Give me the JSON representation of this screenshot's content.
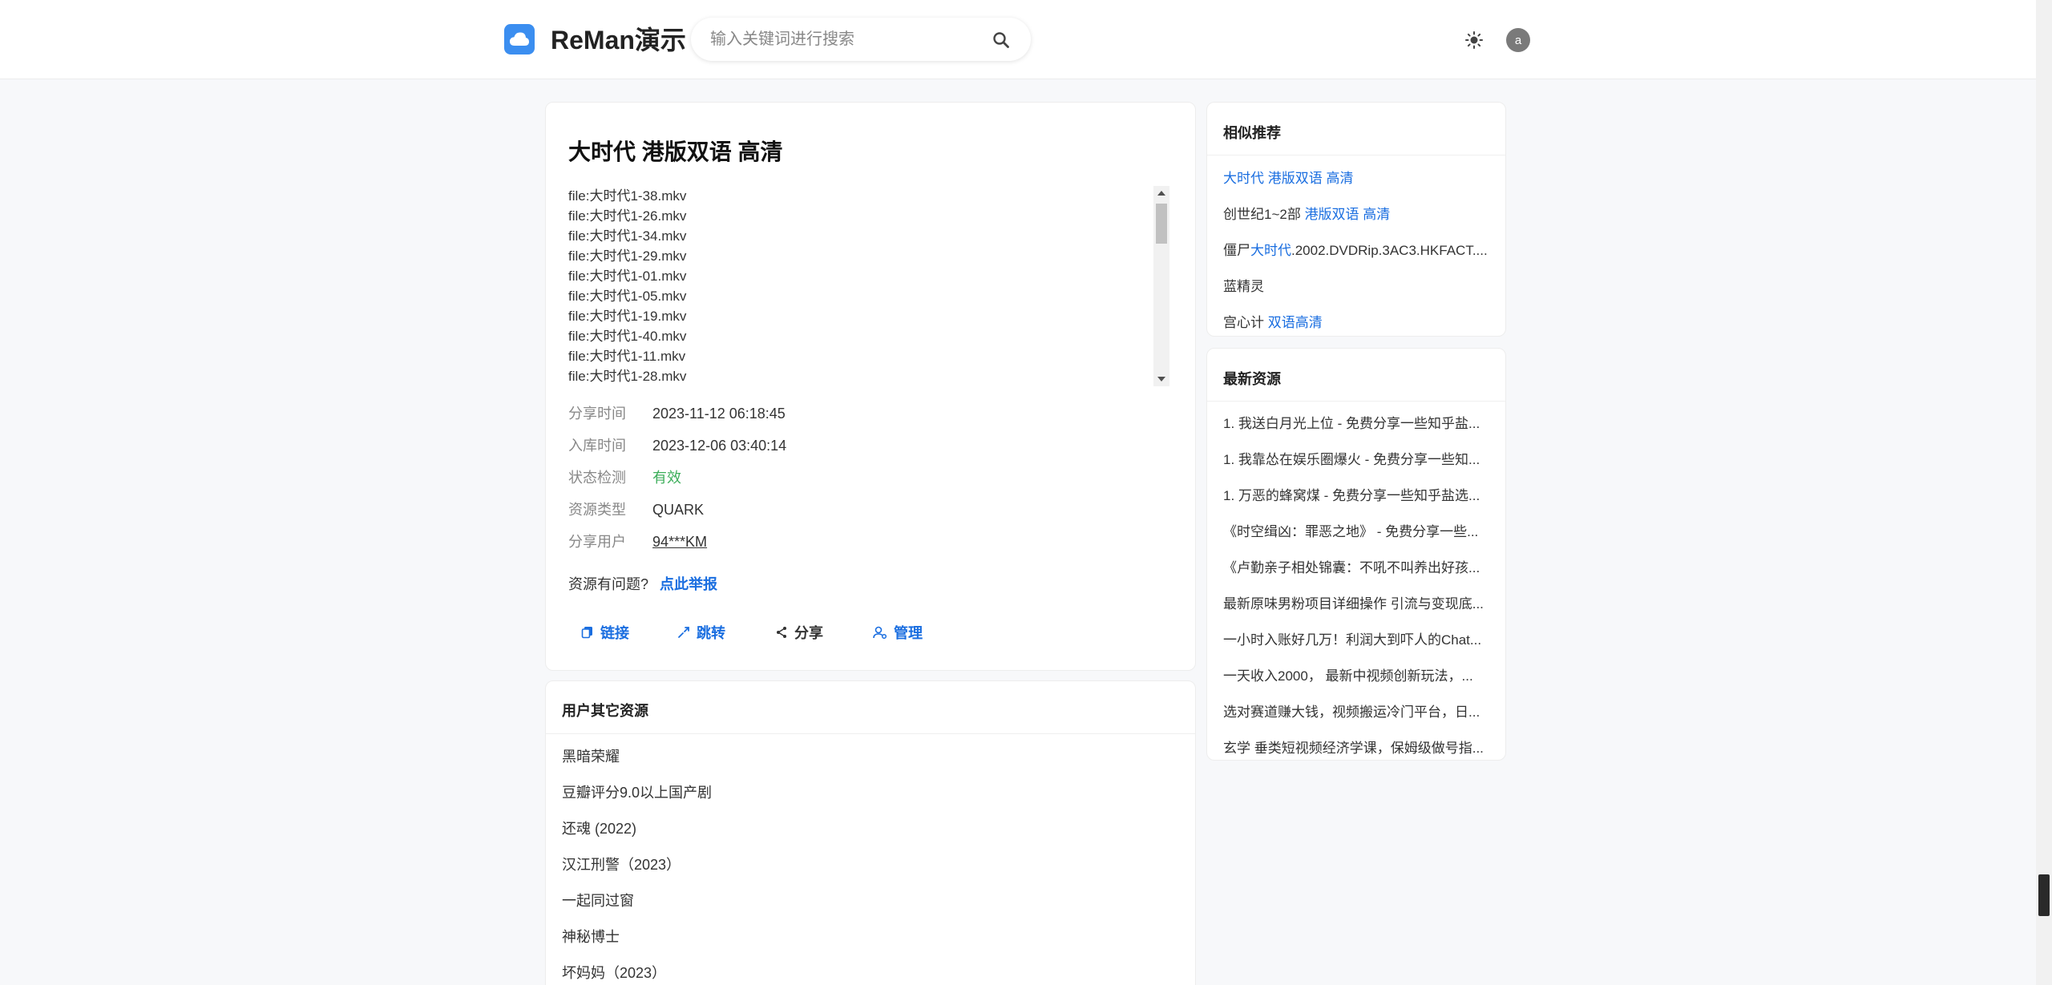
{
  "header": {
    "logo_text": "ReMan演示",
    "search_placeholder": "输入关键词进行搜索",
    "avatar_letter": "a"
  },
  "resource": {
    "title": "大时代 港版双语 高清",
    "files": [
      "file:大时代1-38.mkv",
      "file:大时代1-26.mkv",
      "file:大时代1-34.mkv",
      "file:大时代1-29.mkv",
      "file:大时代1-01.mkv",
      "file:大时代1-05.mkv",
      "file:大时代1-19.mkv",
      "file:大时代1-40.mkv",
      "file:大时代1-11.mkv",
      "file:大时代1-28.mkv"
    ],
    "meta": {
      "share_time_label": "分享时间",
      "share_time": "2023-11-12 06:18:45",
      "stored_time_label": "入库时间",
      "stored_time": "2023-12-06 03:40:14",
      "status_label": "状态检测",
      "status": "有效",
      "type_label": "资源类型",
      "type": "QUARK",
      "user_label": "分享用户",
      "user": "94***KM"
    },
    "report_question": "资源有问题?",
    "report_link": "点此举报",
    "actions": {
      "link": "链接",
      "jump": "跳转",
      "share": "分享",
      "manage": "管理"
    }
  },
  "other": {
    "title": "用户其它资源",
    "items": [
      "黑暗荣耀",
      "豆瓣评分9.0以上国产剧",
      "还魂 (2022)",
      "汉江刑警（2023）",
      "一起同过窗",
      "神秘博士",
      "坏妈妈（2023）"
    ]
  },
  "similar": {
    "title": "相似推荐",
    "items": [
      [
        {
          "t": "大时代 港版双语 高清",
          "h": true
        }
      ],
      [
        {
          "t": "创世纪1~2部 ",
          "h": false
        },
        {
          "t": "港版双语 高清",
          "h": true
        }
      ],
      [
        {
          "t": "僵尸",
          "h": false
        },
        {
          "t": "大时代",
          "h": true
        },
        {
          "t": ".2002.DVDRip.3AC3.HKFACT....",
          "h": false
        }
      ],
      [
        {
          "t": "蓝精灵",
          "h": false
        }
      ],
      [
        {
          "t": "宫心计 ",
          "h": false
        },
        {
          "t": "双语高清",
          "h": true
        }
      ]
    ]
  },
  "latest": {
    "title": "最新资源",
    "items": [
      "1. 我送白月光上位 - 免费分享一些知乎盐...",
      "1. 我靠怂在娱乐圈爆火 - 免费分享一些知...",
      "1. 万恶的蜂窝煤 - 免费分享一些知乎盐选...",
      "《时空缉凶：罪恶之地》 - 免费分享一些...",
      "《卢勤亲子相处锦囊：不吼不叫养出好孩...",
      "最新原味男粉项目详细操作 引流与变现底...",
      "一小时入账好几万！利润大到吓人的Chat...",
      "一天收入2000， 最新中视频创新玩法，...",
      "选对赛道赚大钱，视频搬运冷门平台，日...",
      "玄学 垂类短视频经济学课，保姆级做号指..."
    ]
  },
  "colors": {
    "accent": "#1a6ee0",
    "logo": "#3b8ef0",
    "valid": "#3cae5a"
  }
}
